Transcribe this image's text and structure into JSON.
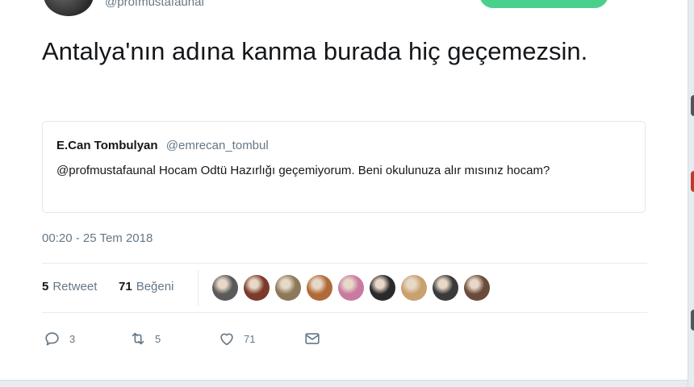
{
  "author": {
    "handle": "@profmustafaunal"
  },
  "tweet": {
    "text": "Antalya'nın adına kanma burada hiç geçemezsin."
  },
  "quoted": {
    "name": "E.Can Tombulyan",
    "handle": "@emrecan_tombul",
    "text": "@profmustafaunal Hocam Odtü Hazırlığı geçemiyorum. Beni okulunuza alır mısınız hocam?"
  },
  "timestamp": "00:20 - 25 Tem 2018",
  "stats": {
    "retweets_count": "5",
    "retweets_label": "Retweet",
    "likes_count": "71",
    "likes_label": "Beğeni"
  },
  "likers": [
    {
      "color": "#5a5a5a"
    },
    {
      "color": "#7a3b2a"
    },
    {
      "color": "#8a7a5a"
    },
    {
      "color": "#b06a3a"
    },
    {
      "color": "#c87aa0"
    },
    {
      "color": "#2a2a2a"
    },
    {
      "color": "#c9a070"
    },
    {
      "color": "#3a3a3a"
    },
    {
      "color": "#6a4a3a"
    }
  ],
  "actions": {
    "reply_count": "3",
    "retweet_count": "5",
    "like_count": "71",
    "reply_icon": "reply-icon",
    "retweet_icon": "retweet-icon",
    "like_icon": "heart-icon",
    "dm_icon": "envelope-icon"
  },
  "colors": {
    "follow_button": "#4ad08d",
    "text_secondary": "#657786",
    "border": "#e1e8ed",
    "edge_red": "#c0392b"
  }
}
